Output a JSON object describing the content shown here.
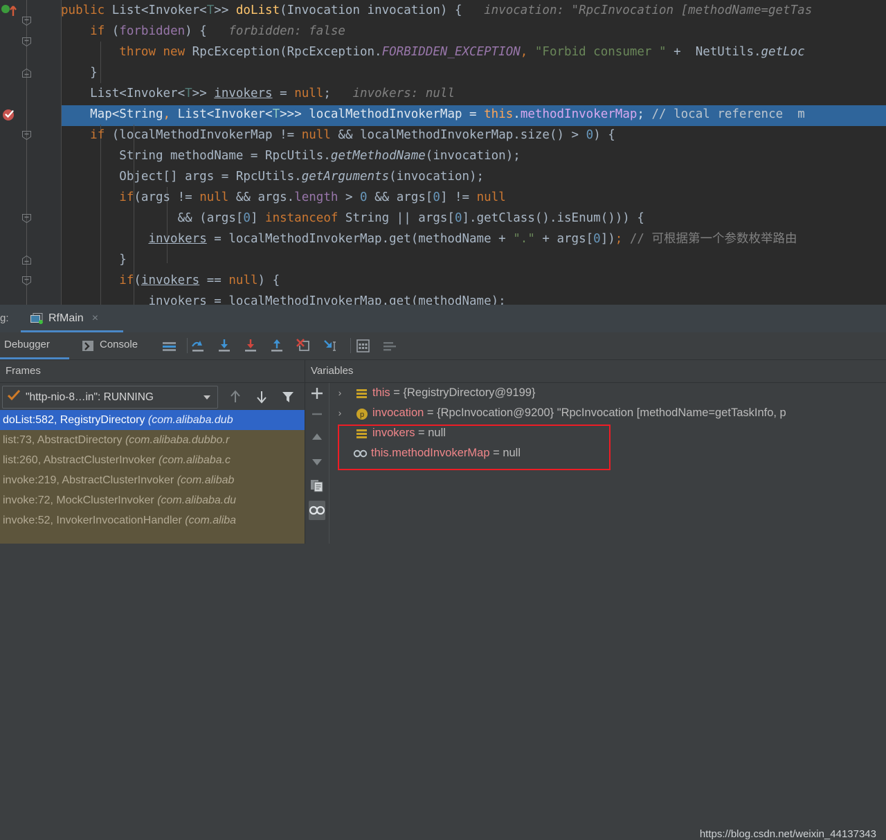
{
  "editor": {
    "language": "java",
    "highlighted_line_index": 5,
    "lines": [
      "public List<Invoker<T>> doList(Invocation invocation) {   invocation: \"RpcInvocation [methodName=getTas",
      "    if (forbidden) {   forbidden: false",
      "        throw new RpcException(RpcException.FORBIDDEN_EXCEPTION, \"Forbid consumer \" +  NetUtils.getLoc",
      "    }",
      "    List<Invoker<T>> invokers = null;   invokers: null",
      "    Map<String, List<Invoker<T>>> localMethodInvokerMap = this.methodInvokerMap; // local reference  m",
      "    if (localMethodInvokerMap != null && localMethodInvokerMap.size() > 0) {",
      "        String methodName = RpcUtils.getMethodName(invocation);",
      "        Object[] args = RpcUtils.getArguments(invocation);",
      "        if(args != null && args.length > 0 && args[0] != null",
      "                && (args[0] instanceof String || args[0].getClass().isEnum())) {",
      "            invokers = localMethodInvokerMap.get(methodName + \".\" + args[0]); // 可根据第一个参数枚举路由",
      "        }",
      "        if(invokers == null) {",
      "            invokers = localMethodInvokerMap.get(methodName);"
    ],
    "inline_hints": [
      "invocation: \"RpcInvocation [methodName=getTas",
      "forbidden: false",
      "invokers: null"
    ],
    "comments": [
      "// local reference",
      "// 可根据第一个参数枚举路由"
    ],
    "breakpoint_line": 5,
    "colors": {
      "background": "#2b2b2b",
      "gutter": "#313335",
      "default_text": "#a9b7c6",
      "keyword": "#cc7832",
      "string": "#6a8759",
      "number": "#6897bb",
      "comment": "#808080",
      "field": "#9876aa",
      "highlight_line": "#2f659b"
    }
  },
  "debug_window": {
    "title_label": "g:",
    "run_tab": {
      "label": "RfMain",
      "close": "×",
      "icon": "run-config-icon",
      "status_dot_color": "#3fbf3f"
    },
    "tabs": [
      {
        "label": "Debugger",
        "selected": true
      },
      {
        "label": "Console",
        "selected": false,
        "icon": "console-icon"
      }
    ],
    "toolbar_icons": [
      "mute-breakpoints-icon",
      "show-execution-point-icon",
      "step-over-icon",
      "step-into-icon",
      "force-step-into-icon",
      "step-out-icon",
      "drop-frame-icon",
      "run-to-cursor-icon",
      "evaluate-expression-icon",
      "settings-icon"
    ]
  },
  "frames": {
    "header": "Frames",
    "thread": {
      "label": "\"http-nio-8…in\": RUNNING",
      "state_icon": "running-check-icon",
      "dropdown": "chevron-down-icon"
    },
    "buttons": [
      "arrow-up-icon",
      "arrow-down-icon",
      "filter-icon"
    ],
    "items": [
      {
        "method": "doList:582, RegistryDirectory",
        "package": "(com.alibaba.dub",
        "selected": true
      },
      {
        "method": "list:73, AbstractDirectory",
        "package": "(com.alibaba.dubbo.r",
        "selected": false
      },
      {
        "method": "list:260, AbstractClusterInvoker",
        "package": "(com.alibaba.c",
        "selected": false
      },
      {
        "method": "invoke:219, AbstractClusterInvoker",
        "package": "(com.alibab",
        "selected": false
      },
      {
        "method": "invoke:72, MockClusterInvoker",
        "package": "(com.alibaba.du",
        "selected": false
      },
      {
        "method": "invoke:52, InvokerInvocationHandler",
        "package": "(com.aliba",
        "selected": false
      }
    ]
  },
  "variables": {
    "header": "Variables",
    "side_buttons": [
      "add-watch-icon",
      "remove-watch-icon",
      "move-up-icon",
      "move-down-icon",
      "copy-icon",
      "watches-icon"
    ],
    "active_side_button": "watches-icon",
    "rows": [
      {
        "expandable": true,
        "icon": "field-icon",
        "name": "this",
        "value": "= {RegistryDirectory@9199}",
        "highlighted": false
      },
      {
        "expandable": true,
        "icon": "parameter-icon",
        "name": "invocation",
        "value": "= {RpcInvocation@9200} \"RpcInvocation [methodName=getTaskInfo, p",
        "highlighted": false
      },
      {
        "expandable": false,
        "icon": "field-icon",
        "name": "invokers",
        "value": "= null",
        "highlighted": true
      },
      {
        "expandable": false,
        "icon": "watches-icon",
        "name": "this.methodInvokerMap",
        "value": "= null",
        "highlighted": true
      }
    ],
    "highlight_color": "#ee1c25"
  },
  "watermark": "https://blog.csdn.net/weixin_44137343"
}
